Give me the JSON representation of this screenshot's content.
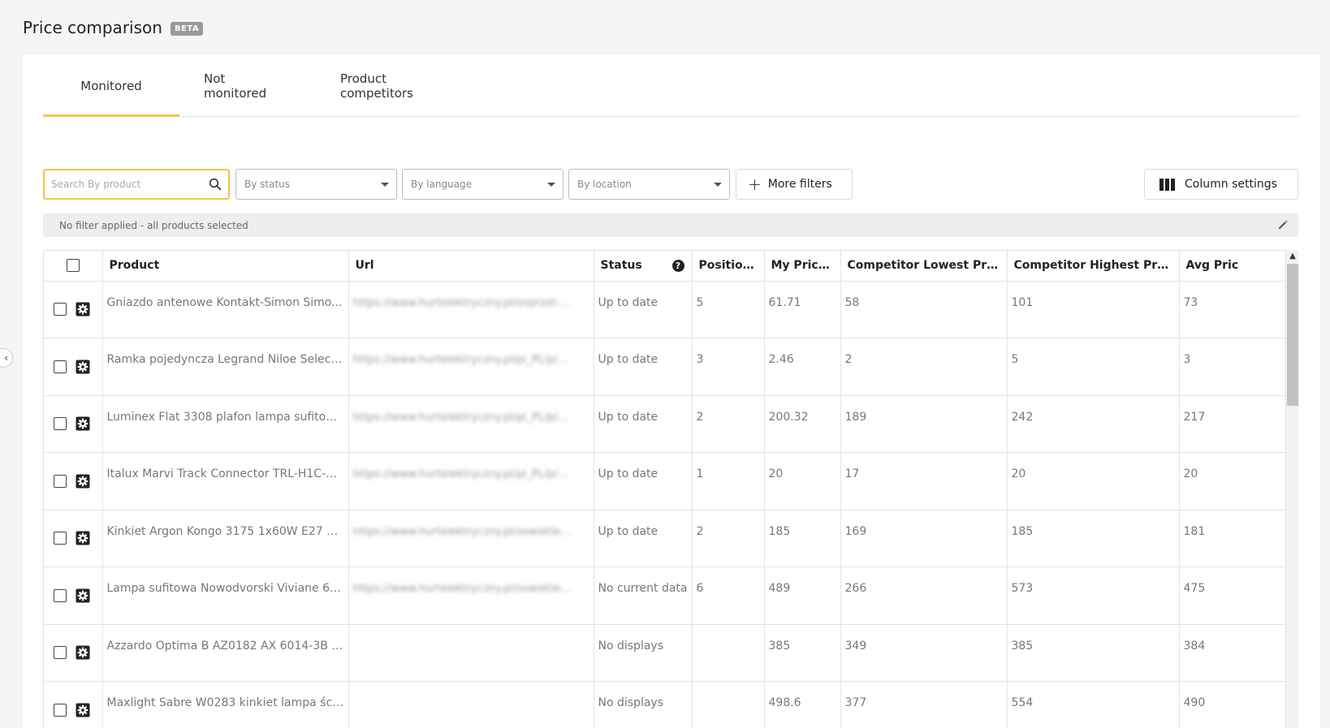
{
  "header": {
    "title": "Price comparison",
    "badge": "BETA"
  },
  "tabs": [
    {
      "label": "Monitored",
      "active": true
    },
    {
      "label": "Not monitored",
      "active": false
    },
    {
      "label": "Product competitors",
      "active": false
    }
  ],
  "toolbar": {
    "search_placeholder": "Search By product",
    "search_value": "",
    "status_select": "By status",
    "language_select": "By language",
    "location_select": "By location",
    "more_filters_label": "More filters",
    "column_settings_label": "Column settings"
  },
  "filter_bar": {
    "text": "No filter applied - all products selected"
  },
  "table": {
    "columns": [
      "Product",
      "Url",
      "Status",
      "Position ...",
      "My Price ...",
      "Competitor Lowest Price ...",
      "Competitor Highest Price ...",
      "Avg Pric"
    ],
    "rows": [
      {
        "product": "Gniazdo antenowe Kontakt-Simon Simo...",
        "url": "https://www.hurtelektryczny.pl/osprzet-...",
        "status": "Up to date",
        "position": "5",
        "my_price": "61.71",
        "lowest": "58",
        "highest": "101",
        "avg": "73"
      },
      {
        "product": "Ramka pojedyncza Legrand Niloe Select...",
        "url": "https://www.hurtelektryczny.pl/pl_PL/p/...",
        "status": "Up to date",
        "position": "3",
        "my_price": "2.46",
        "lowest": "2",
        "highest": "5",
        "avg": "3"
      },
      {
        "product": "Luminex Flat 3308 plafon lampa sufitow...",
        "url": "https://www.hurtelektryczny.pl/pl_PL/p/...",
        "status": "Up to date",
        "position": "2",
        "my_price": "200.32",
        "lowest": "189",
        "highest": "242",
        "avg": "217"
      },
      {
        "product": "Italux Marvi Track Connector TRL-H1C-C...",
        "url": "https://www.hurtelektryczny.pl/pl_PL/p/...",
        "status": "Up to date",
        "position": "1",
        "my_price": "20",
        "lowest": "17",
        "highest": "20",
        "avg": "20"
      },
      {
        "product": "Kinkiet Argon Kongo 3175 1x60W E27 czar...",
        "url": "https://www.hurtelektryczny.pl/oswietle...",
        "status": "Up to date",
        "position": "2",
        "my_price": "185",
        "lowest": "169",
        "highest": "185",
        "avg": "181"
      },
      {
        "product": "Lampa sufitowa Nowodvorski Viviane 65...",
        "url": "https://www.hurtelektryczny.pl/oswietle...",
        "status": "No current data",
        "position": "6",
        "my_price": "489",
        "lowest": "266",
        "highest": "573",
        "avg": "475"
      },
      {
        "product": "Azzardo Optima B AZ0182 AX 6014-3B Kin...",
        "url": "",
        "status": "No displays",
        "position": "",
        "my_price": "385",
        "lowest": "349",
        "highest": "385",
        "avg": "384"
      },
      {
        "product": "Maxlight Sabre W0283 kinkiet lampa ści...",
        "url": "",
        "status": "No displays",
        "position": "",
        "my_price": "498.6",
        "lowest": "377",
        "highest": "554",
        "avg": "490"
      }
    ]
  },
  "icons": {
    "search": "search-icon",
    "caret": "chevron-down-icon",
    "plus": "plus-icon",
    "columns": "columns-icon",
    "edit": "pencil-icon",
    "help": "help-icon",
    "gear": "gear-icon",
    "collapse": "chevron-left-icon"
  },
  "colors": {
    "accent": "#f3c445",
    "badge": "#9a9a9a"
  }
}
